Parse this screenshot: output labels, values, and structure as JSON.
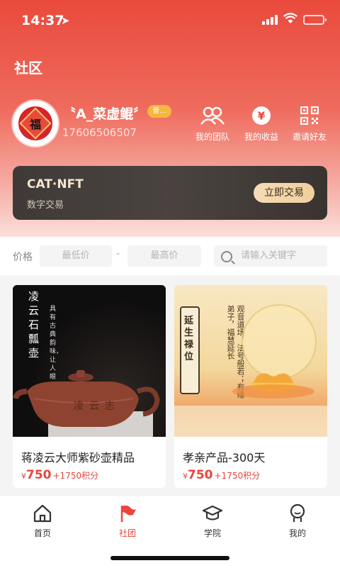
{
  "status_bar": {
    "time": "14:37",
    "location_icon": "location-arrow-icon"
  },
  "header": {
    "title": "社区"
  },
  "profile": {
    "avatar_char": "福",
    "username": "〝A_菜虚鲲〞",
    "badge": "普...",
    "phone": "17606506507"
  },
  "quick_actions": [
    {
      "label": "我的团队",
      "icon": "team-icon"
    },
    {
      "label": "我的收益",
      "icon": "yen-icon"
    },
    {
      "label": "邀请好友",
      "icon": "qrcode-icon"
    }
  ],
  "nft_banner": {
    "title": "CAT·NFT",
    "subtitle": "数字交易",
    "button": "立即交易"
  },
  "filter": {
    "price_label": "价格",
    "min_placeholder": "最低价",
    "dash": "-",
    "max_placeholder": "最高价",
    "search_placeholder": "请输入关键字"
  },
  "products": [
    {
      "name": "蒋凌云大师紫砂壶精品",
      "yen": "¥",
      "price": "750",
      "points": "+1750积分",
      "image_text_title": "凌云石瓢壶",
      "image_text_sub": "具有古典韵味，让人眼前一亮",
      "image_text_pot": "凌云志"
    },
    {
      "name": "孝亲产品-300天",
      "yen": "¥",
      "price": "750",
      "points": "+1750积分",
      "image_text_title": "延生禄位",
      "image_text_verse": "观音道场，法号般若；有缘弟子，福慧延长"
    }
  ],
  "tabbar": [
    {
      "label": "首页",
      "icon": "home-icon",
      "active": false
    },
    {
      "label": "社团",
      "icon": "flag-icon",
      "active": true
    },
    {
      "label": "学院",
      "icon": "graduation-cap-icon",
      "active": false
    },
    {
      "label": "我的",
      "icon": "user-icon",
      "active": false
    }
  ],
  "colors": {
    "accent": "#e8453c",
    "nft_gold": "#efcf9e"
  }
}
